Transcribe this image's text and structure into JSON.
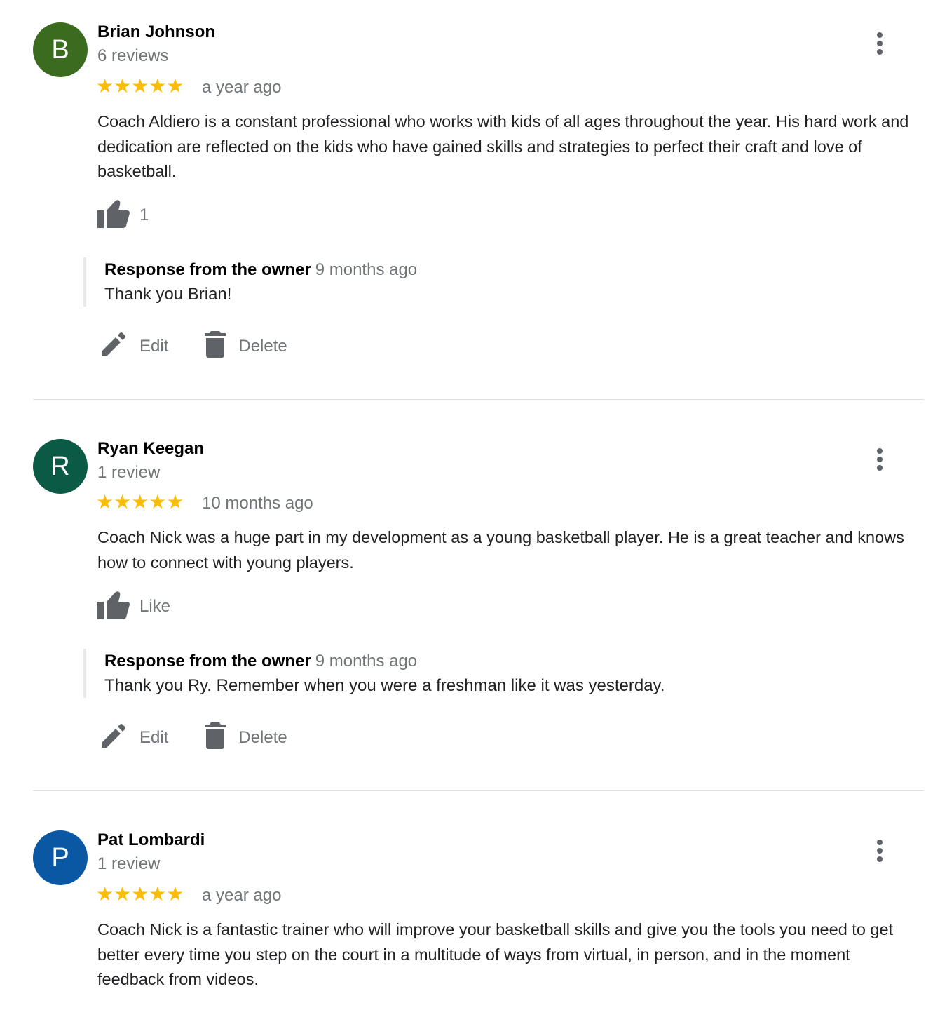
{
  "icons": {
    "more": "more-vert-icon",
    "like": "thumb-up-icon",
    "edit": "pencil-icon",
    "delete": "trash-icon",
    "star": "star-icon"
  },
  "colors": {
    "star": "#fbbc04",
    "secondary_text": "#70757a",
    "icon": "#5f6368"
  },
  "reviews": [
    {
      "initial": "B",
      "avatar_color": "#3b6b1f",
      "name": "Brian Johnson",
      "review_count": "6 reviews",
      "stars": "★★★★★",
      "rating": 5,
      "date": "a year ago",
      "text": "Coach Aldiero is a constant professional who works with kids of all ages throughout the year. His hard work and dedication are reflected on the kids who have gained skills and strategies to perfect their craft and love of basketball.",
      "like_label": "1",
      "response": {
        "title": "Response from the owner",
        "date": "9 months ago",
        "text": "Thank you Brian!"
      },
      "edit_label": "Edit",
      "delete_label": "Delete"
    },
    {
      "initial": "R",
      "avatar_color": "#0b5a45",
      "name": "Ryan Keegan",
      "review_count": "1 review",
      "stars": "★★★★★",
      "rating": 5,
      "date": "10 months ago",
      "text": "Coach Nick was a huge part in my development as a young basketball player. He is a great teacher and knows how to connect with young players.",
      "like_label": "Like",
      "response": {
        "title": "Response from the owner",
        "date": "9 months ago",
        "text": "Thank you Ry. Remember when you were a freshman like it was yesterday."
      },
      "edit_label": "Edit",
      "delete_label": "Delete"
    },
    {
      "initial": "P",
      "avatar_color": "#0a57a4",
      "name": "Pat Lombardi",
      "review_count": "1 review",
      "stars": "★★★★★",
      "rating": 5,
      "date": "a year ago",
      "text": "Coach Nick is a fantastic trainer who will improve your basketball skills and give you the tools you need to get better every time you step on the court in a multitude of ways from virtual, in person, and in the moment feedback from videos."
    }
  ]
}
